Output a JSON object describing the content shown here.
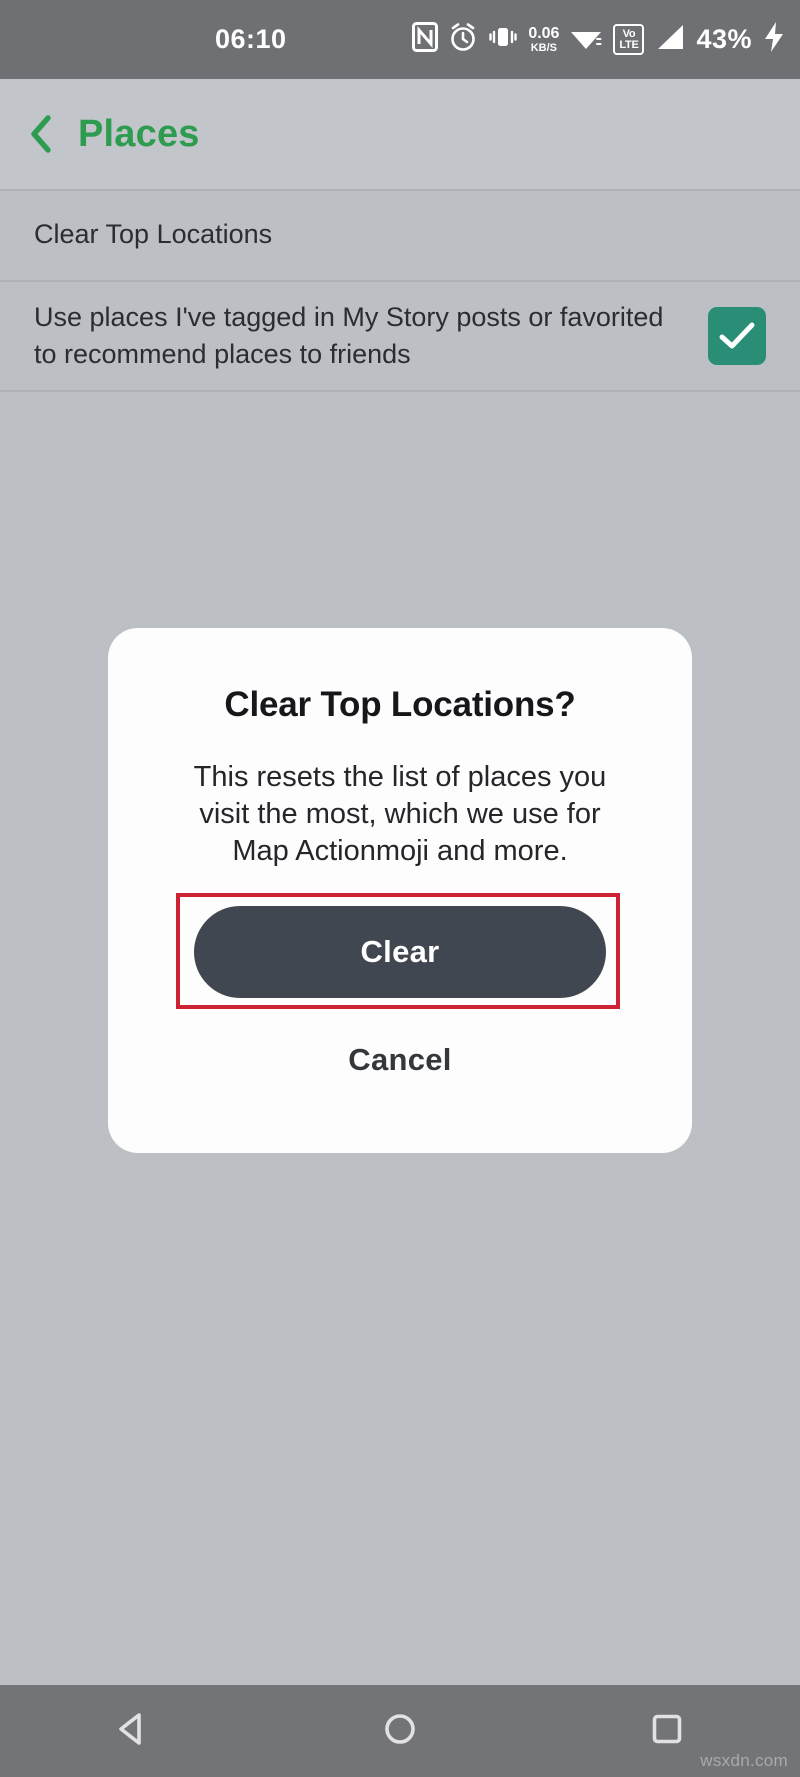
{
  "status_bar": {
    "clock": "06:10",
    "data_rate_value": "0.06",
    "data_rate_unit": "KB/S",
    "volte_top": "Vo",
    "volte_bottom": "LTE",
    "battery_percent": "43%",
    "icons": [
      "nfc-icon",
      "alarm-icon",
      "vibrate-icon",
      "data-rate-icon",
      "wifi-icon",
      "volte-icon",
      "cellular-signal-icon",
      "battery-charging-icon"
    ]
  },
  "header": {
    "title": "Places",
    "back_icon": "back-chevron-icon",
    "accent_color": "#2d9c4f"
  },
  "settings": {
    "rows": [
      {
        "label": "Clear Top Locations",
        "has_checkbox": false
      },
      {
        "label": "Use places I've tagged in My Story posts or favorited to recommend places to friends",
        "has_checkbox": true,
        "checked": true,
        "checkbox_color": "#2a8d76"
      }
    ]
  },
  "dialog": {
    "title": "Clear Top Locations?",
    "body": "This resets the list of places you visit the most, which we use for Map Actionmoji and more.",
    "primary_button": "Clear",
    "primary_button_color": "#414750",
    "secondary_button": "Cancel",
    "highlight_color": "#cc2233"
  },
  "nav_bar": {
    "back_label": "back-triangle-icon",
    "home_label": "home-circle-icon",
    "recents_label": "recents-square-icon"
  },
  "watermark": "wsxdn.com"
}
